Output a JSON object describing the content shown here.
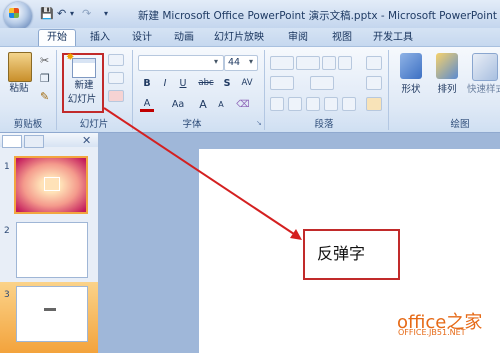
{
  "window": {
    "title": "新建 Microsoft Office PowerPoint 演示文稿.pptx - Microsoft PowerPoint"
  },
  "tabs": [
    "开始",
    "插入",
    "设计",
    "动画",
    "幻灯片放映",
    "审阅",
    "视图",
    "开发工具"
  ],
  "ribbon": {
    "clipboard": {
      "paste_label": "粘贴",
      "group_label": "剪贴板"
    },
    "slides": {
      "new_slide_label_line1": "新建",
      "new_slide_label_line2": "幻灯片",
      "group_label": "幻灯片"
    },
    "font": {
      "size_value": "44",
      "bold": "B",
      "italic": "I",
      "underline": "U",
      "strike": "abc",
      "shadow": "S",
      "spacing": "AV",
      "case": "Aa",
      "grow": "A",
      "shrink": "A",
      "group_label": "字体"
    },
    "paragraph": {
      "group_label": "段落"
    },
    "drawing": {
      "shapes_label": "形状",
      "arrange_label": "排列",
      "quick_styles_label": "快速样式",
      "group_label": "绘图"
    }
  },
  "slides": [
    {
      "number": "1"
    },
    {
      "number": "2"
    },
    {
      "number": "3"
    }
  ],
  "textbox": {
    "text": "反弹字"
  },
  "watermark": {
    "main": "office之家",
    "sub": "OFFICE.JB51.NET"
  },
  "colors": {
    "accent_red": "#c12a2a",
    "ribbon_bg": "#dfe9f6",
    "watermark": "#e66a17"
  }
}
